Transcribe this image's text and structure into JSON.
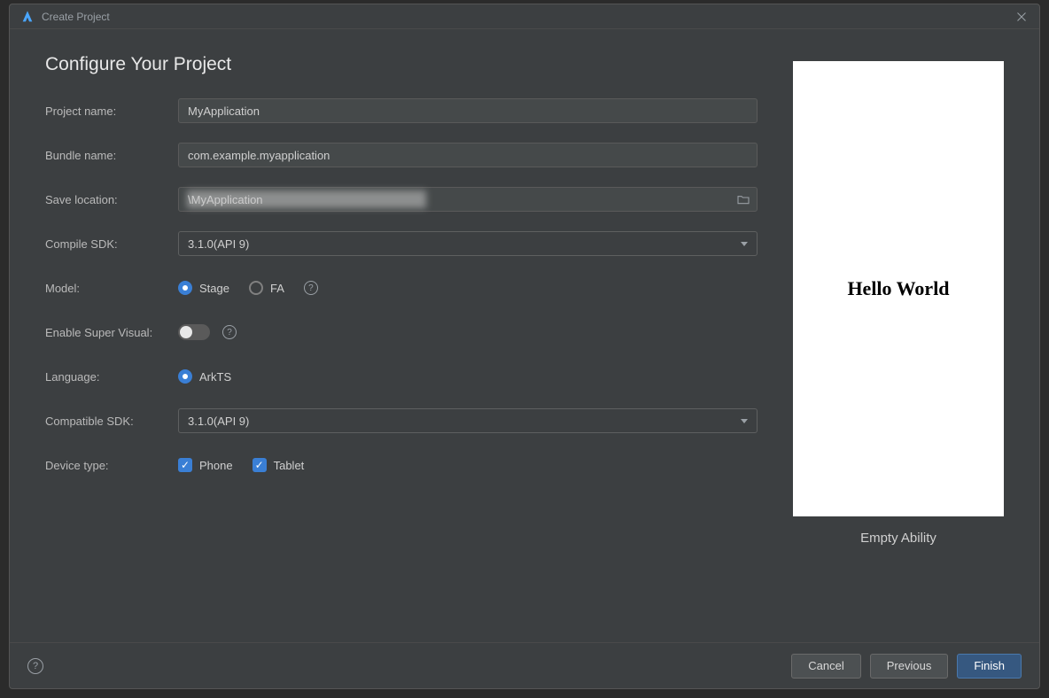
{
  "window": {
    "title": "Create Project"
  },
  "page": {
    "heading": "Configure Your Project"
  },
  "form": {
    "project_name": {
      "label": "Project name:",
      "value": "MyApplication"
    },
    "bundle_name": {
      "label": "Bundle name:",
      "value": "com.example.myapplication"
    },
    "save_location": {
      "label": "Save location:",
      "value": "\\MyApplication"
    },
    "compile_sdk": {
      "label": "Compile SDK:",
      "value": "3.1.0(API 9)"
    },
    "model": {
      "label": "Model:",
      "options": [
        {
          "label": "Stage",
          "checked": true
        },
        {
          "label": "FA",
          "checked": false
        }
      ]
    },
    "super_visual": {
      "label": "Enable Super Visual:",
      "enabled": false
    },
    "language": {
      "label": "Language:",
      "options": [
        {
          "label": "ArkTS",
          "checked": true
        }
      ]
    },
    "compatible_sdk": {
      "label": "Compatible SDK:",
      "value": "3.1.0(API 9)"
    },
    "device_type": {
      "label": "Device type:",
      "options": [
        {
          "label": "Phone",
          "checked": true
        },
        {
          "label": "Tablet",
          "checked": true
        }
      ]
    }
  },
  "preview": {
    "content": "Hello World",
    "caption": "Empty Ability"
  },
  "footer": {
    "cancel": "Cancel",
    "previous": "Previous",
    "finish": "Finish"
  }
}
